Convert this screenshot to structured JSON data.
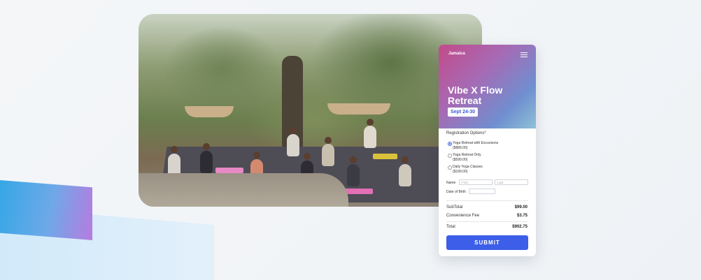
{
  "photo": {
    "alt": "Outdoor yoga retreat group among olive trees"
  },
  "form": {
    "brand": "Jamaica",
    "menu_icon": "hamburger-menu-icon",
    "title": "Vibe X Flow Retreat",
    "dates": "Sept 24-30",
    "registration_label": "Registration Options*",
    "options": [
      {
        "label": "Yoga Retreat with Excursions",
        "price": "($889.00)",
        "selected": true
      },
      {
        "label": "Yoga Retreat Only",
        "price": "($599.00)",
        "selected": false
      },
      {
        "label": "Daily Yoga Classes",
        "price": "($199.00)",
        "selected": false
      }
    ],
    "name_label": "Name",
    "first_placeholder": "First",
    "last_placeholder": "Last",
    "dob_label": "Date of Birth",
    "subtotal_label": "SubTotal",
    "subtotal_value": "$99.00",
    "fee_label": "Convenience Fee",
    "fee_value": "$3.75",
    "total_label": "Total",
    "total_value": "$902.75",
    "submit_label": "SUBMIT"
  },
  "colors": {
    "accent": "#3d5ee8",
    "hero_pink": "#c44a8a",
    "hero_blue": "#6f8fd0"
  }
}
